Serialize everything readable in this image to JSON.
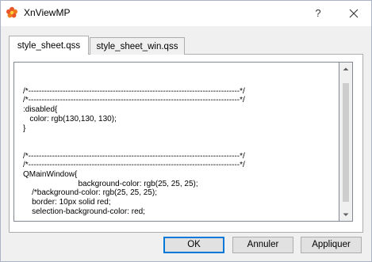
{
  "window": {
    "title": "XnViewMP",
    "help_label": "?",
    "icon": "xnview-flower-icon"
  },
  "tabs": [
    {
      "label": "style_sheet.qss",
      "active": true
    },
    {
      "label": "style_sheet_win.qss",
      "active": false
    }
  ],
  "editor": {
    "content": "\n/*--------------------------------------------------------------------------------*/\n/*--------------------------------------------------------------------------------*/\n:disabled{\n   color: rgb(130,130, 130);\n}\n\n\n/*--------------------------------------------------------------------------------*/\n/*--------------------------------------------------------------------------------*/\nQMainWindow{\n                         background-color: rgb(25, 25, 25);\n    /*background-color: rgb(25, 25, 25);\n    border: 10px solid red;\n    selection-background-color: red;"
  },
  "buttons": {
    "ok": "OK",
    "cancel": "Annuler",
    "apply": "Appliquer"
  },
  "colors": {
    "accent": "#0078d7",
    "window_bg": "#f0f0f0"
  }
}
